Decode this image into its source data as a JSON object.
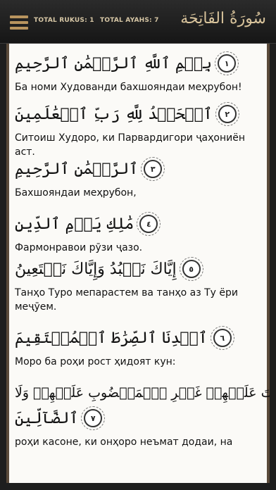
{
  "header": {
    "total_rukus": "TOTAL RUKUS: 1",
    "total_ayahs": "TOTAL AYAHS: 7",
    "surah_title": "سُورَةُ الفَاتِحَة"
  },
  "ayahs": [
    {
      "number": "١",
      "arabic": "بِسۡمِ ٱللَّهِ ٱلرَّحۡمَٰنِ ٱلرَّحِيمِ",
      "translation": "Ба номи Худованди бахшояндаи меҳрубон!"
    },
    {
      "number": "٢",
      "arabic": "ٱلۡحَمۡدُ لِلَّهِ رَبِّ ٱلۡعَٰلَمِينَ",
      "translation": "Ситоиш Худоро, ки Парвардигори ҷаҳониён аст."
    },
    {
      "number": "٣",
      "arabic": "ٱلرَّحۡمَٰنِ ٱلرَّحِيمِ",
      "translation": "Бахшояндаи меҳрубон,"
    },
    {
      "number": "٤",
      "arabic": "مَٰلِكِ يَوۡمِ ٱلدِّينِ",
      "translation": "Фармонравои рӯзи ҷазо."
    },
    {
      "number": "٥",
      "arabic": "إِيَّاكَ نَعۡبُدُ وَإِيَّاكَ نَسۡتَعِينُ",
      "translation": "Танҳо Туро мепарастем ва танҳо аз Ту ёри меҷӯем."
    },
    {
      "number": "٦",
      "arabic": "ٱهۡدِنَا ٱلصِّرَٰطَ ٱلۡمُسۡتَقِيمَ",
      "translation": "Моро ба роҳи рост ҳидоят кун:"
    },
    {
      "number": "٧",
      "arabic": "صِرَٰطَ ٱلَّذِينَ أَنۡعَمۡتَ عَلَيۡهِمۡ غَيۡرِ ٱلۡمَغۡضُوبِ عَلَيۡهِمۡ وَلَا",
      "arabic_2": "ٱلضَّآلِّينَ",
      "translation": "роҳи касоне, ки онҳоро неъмат додаи, на"
    }
  ]
}
